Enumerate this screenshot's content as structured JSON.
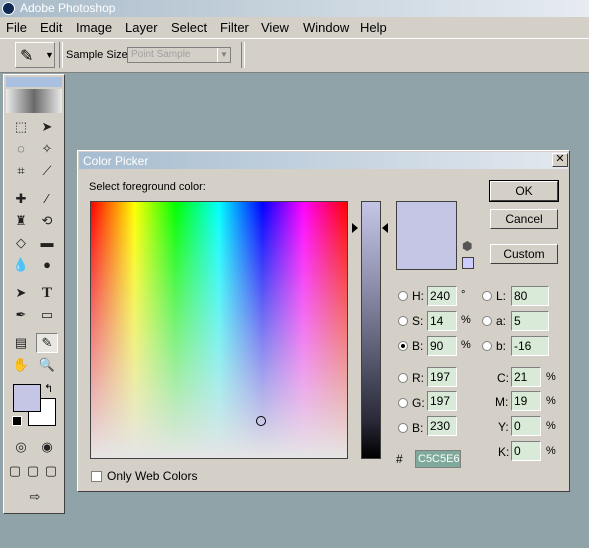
{
  "window": {
    "title": "Adobe Photoshop"
  },
  "menu": [
    "File",
    "Edit",
    "Image",
    "Layer",
    "Select",
    "Filter",
    "View",
    "Window",
    "Help"
  ],
  "options": {
    "sample_size_label": "Sample Size:",
    "sample_size_value": "Point Sample"
  },
  "colors": {
    "foreground": "#C5C5E6",
    "background": "#FFFFFF",
    "web_safe": "#CCCCFF",
    "canvas": "#8FA3A8"
  },
  "dialog": {
    "title": "Color Picker",
    "prompt": "Select foreground color:",
    "buttons": {
      "ok": "OK",
      "cancel": "Cancel",
      "custom": "Custom"
    },
    "selected_mode": "B",
    "hsb": [
      {
        "label": "H:",
        "value": "240",
        "unit": "°"
      },
      {
        "label": "S:",
        "value": "14",
        "unit": "%"
      },
      {
        "label": "B:",
        "value": "90",
        "unit": "%"
      }
    ],
    "rgb": [
      {
        "label": "R:",
        "value": "197"
      },
      {
        "label": "G:",
        "value": "197"
      },
      {
        "label": "B:",
        "value": "230"
      }
    ],
    "lab": [
      {
        "label": "L:",
        "value": "80"
      },
      {
        "label": "a:",
        "value": "5"
      },
      {
        "label": "b:",
        "value": "-16"
      }
    ],
    "cmyk": [
      {
        "label": "C:",
        "value": "21",
        "unit": "%"
      },
      {
        "label": "M:",
        "value": "19",
        "unit": "%"
      },
      {
        "label": "Y:",
        "value": "0",
        "unit": "%"
      },
      {
        "label": "K:",
        "value": "0",
        "unit": "%"
      }
    ],
    "hex_label": "#",
    "hex": "C5C5E6",
    "only_web_colors": "Only Web Colors",
    "only_web_colors_checked": false
  }
}
